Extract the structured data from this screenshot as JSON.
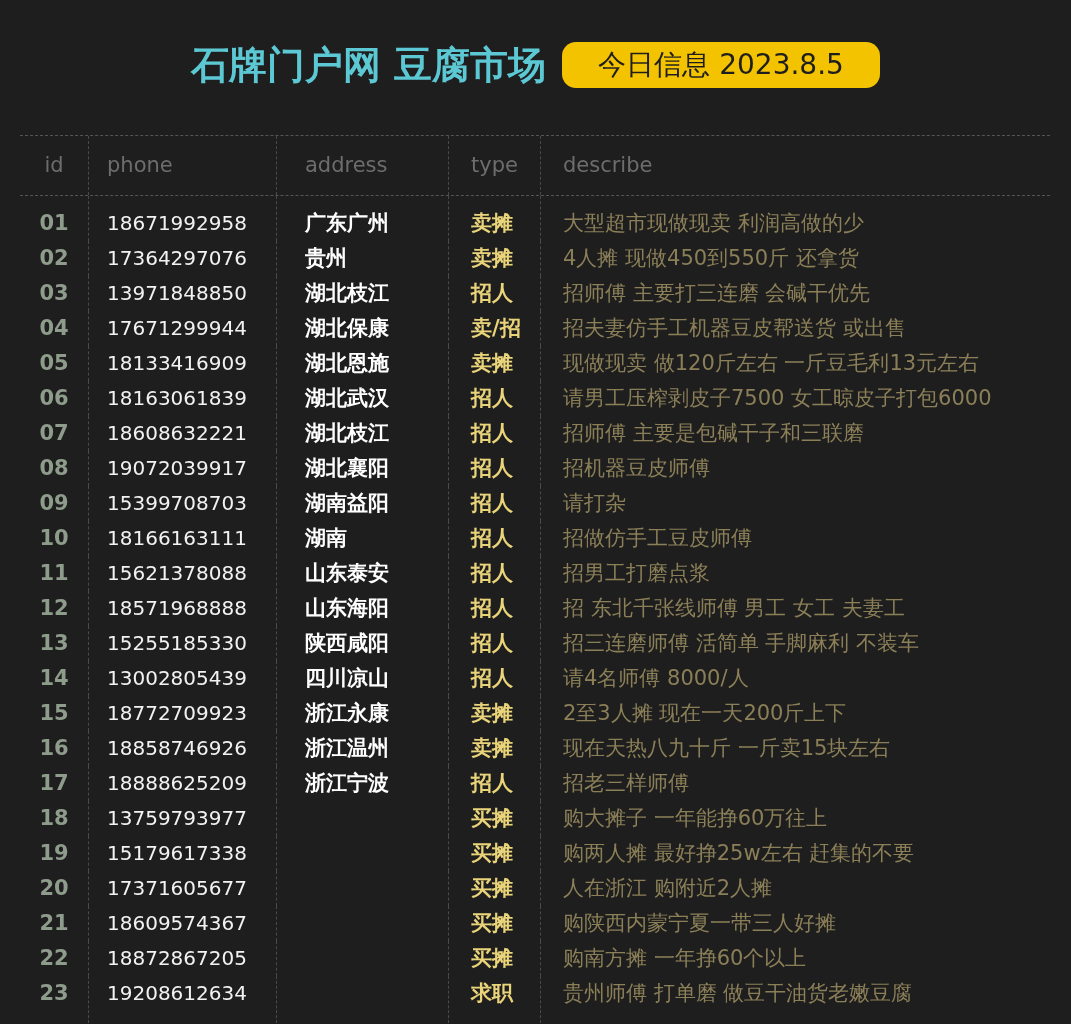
{
  "header": {
    "title": "石牌门户网 豆腐市场",
    "badge": "今日信息 2023.8.5"
  },
  "table": {
    "columns": [
      "id",
      "phone",
      "address",
      "type",
      "describe"
    ],
    "rows": [
      {
        "id": "01",
        "phone": "18671992958",
        "address": "广东广州",
        "type": "卖摊",
        "describe": "大型超市现做现卖 利润高做的少"
      },
      {
        "id": "02",
        "phone": "17364297076",
        "address": "贵州",
        "type": "卖摊",
        "describe": "4人摊 现做450到550斤 还拿货"
      },
      {
        "id": "03",
        "phone": "13971848850",
        "address": "湖北枝江",
        "type": "招人",
        "describe": "招师傅 主要打三连磨 会碱干优先"
      },
      {
        "id": "04",
        "phone": "17671299944",
        "address": "湖北保康",
        "type": "卖/招",
        "describe": "招夫妻仿手工机器豆皮帮送货 或出售"
      },
      {
        "id": "05",
        "phone": "18133416909",
        "address": "湖北恩施",
        "type": "卖摊",
        "describe": "现做现卖 做120斤左右 一斤豆毛利13元左右"
      },
      {
        "id": "06",
        "phone": "18163061839",
        "address": "湖北武汉",
        "type": "招人",
        "describe": "请男工压榨剥皮子7500 女工晾皮子打包6000"
      },
      {
        "id": "07",
        "phone": "18608632221",
        "address": "湖北枝江",
        "type": "招人",
        "describe": "招师傅 主要是包碱干子和三联磨"
      },
      {
        "id": "08",
        "phone": "19072039917",
        "address": "湖北襄阳",
        "type": "招人",
        "describe": "招机器豆皮师傅"
      },
      {
        "id": "09",
        "phone": "15399708703",
        "address": "湖南益阳",
        "type": "招人",
        "describe": "请打杂"
      },
      {
        "id": "10",
        "phone": "18166163111",
        "address": "湖南",
        "type": "招人",
        "describe": "招做仿手工豆皮师傅"
      },
      {
        "id": "11",
        "phone": "15621378088",
        "address": "山东泰安",
        "type": "招人",
        "describe": "招男工打磨点浆"
      },
      {
        "id": "12",
        "phone": "18571968888",
        "address": "山东海阳",
        "type": "招人",
        "describe": "招 东北千张线师傅 男工 女工 夫妻工"
      },
      {
        "id": "13",
        "phone": "15255185330",
        "address": "陕西咸阳",
        "type": "招人",
        "describe": "招三连磨师傅 活简单 手脚麻利 不装车"
      },
      {
        "id": "14",
        "phone": "13002805439",
        "address": "四川凉山",
        "type": "招人",
        "describe": "请4名师傅 8000/人"
      },
      {
        "id": "15",
        "phone": "18772709923",
        "address": "浙江永康",
        "type": "卖摊",
        "describe": "2至3人摊 现在一天200斤上下"
      },
      {
        "id": "16",
        "phone": "18858746926",
        "address": "浙江温州",
        "type": "卖摊",
        "describe": "现在天热八九十斤 一斤卖15块左右"
      },
      {
        "id": "17",
        "phone": "18888625209",
        "address": "浙江宁波",
        "type": "招人",
        "describe": "招老三样师傅"
      },
      {
        "id": "18",
        "phone": "13759793977",
        "type": "买摊",
        "describe": "购大摊子 一年能挣60万往上"
      },
      {
        "id": "19",
        "phone": "15179617338",
        "type": "买摊",
        "describe": "购两人摊 最好挣25w左右 赶集的不要"
      },
      {
        "id": "20",
        "phone": "17371605677",
        "type": "买摊",
        "describe": "人在浙江 购附近2人摊"
      },
      {
        "id": "21",
        "phone": "18609574367",
        "type": "买摊",
        "describe": "购陕西内蒙宁夏一带三人好摊"
      },
      {
        "id": "22",
        "phone": "18872867205",
        "type": "买摊",
        "describe": "购南方摊 一年挣60个以上"
      },
      {
        "id": "23",
        "phone": "19208612634",
        "type": "求职",
        "describe": "贵州师傅 打单磨 做豆干油货老嫩豆腐"
      }
    ]
  }
}
